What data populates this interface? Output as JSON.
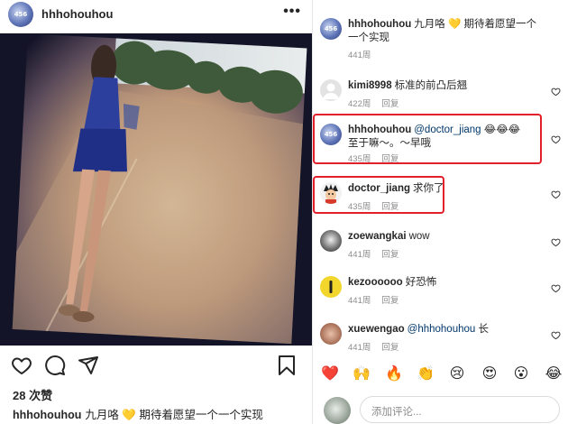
{
  "post": {
    "username": "hhhohouhou",
    "avatar_tag": "456",
    "likes_text": "28 次赞",
    "caption_user": "hhhohouhou",
    "caption_text": "九月咯 💛 期待着愿望一个一个实现"
  },
  "comments": [
    {
      "user": "hhhohouhou",
      "text": "九月咯 💛 期待着愿望一个一个实现",
      "time": "441周",
      "reply": ""
    },
    {
      "user": "kimi8998",
      "text": "标准的前凸后翘",
      "time": "422周",
      "reply": "回复"
    },
    {
      "user": "hhhohouhou",
      "mention": "@doctor_jiang",
      "text": "😂😂😂 至于嘛～。～早哦",
      "time": "435周",
      "reply": "回复"
    },
    {
      "user": "doctor_jiang",
      "text": "求你了",
      "time": "435周",
      "reply": "回复"
    },
    {
      "user": "zoewangkai",
      "text": "wow",
      "time": "441周",
      "reply": "回复"
    },
    {
      "user": "kezoooooo",
      "text": "好恐怖",
      "time": "441周",
      "reply": "回复"
    },
    {
      "user": "xuewengao",
      "mention": "@hhhohouhou",
      "text": "长",
      "time": "441周",
      "reply": "回复"
    }
  ],
  "emoji_bar": [
    "❤️",
    "🙌",
    "🔥",
    "👏",
    "😢",
    "😍",
    "😮",
    "😂"
  ],
  "add_comment": {
    "placeholder": "添加评论..."
  },
  "colors": {
    "highlight": "#e0202a",
    "mention": "#00376b",
    "meta": "#8e8e8e"
  }
}
